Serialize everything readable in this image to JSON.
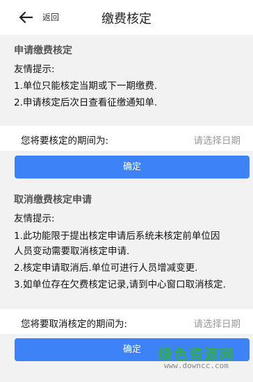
{
  "header": {
    "back_label": "返回",
    "title": "缴费核定"
  },
  "apply_section": {
    "title": "申请缴费核定",
    "tips": [
      "友情提示:",
      "1.单位只能核定当期或下一期缴费.",
      "2.申请核定后次日查看征缴通知单."
    ],
    "period_label": "您将要核定的期间为:",
    "period_placeholder": "请选择日期",
    "confirm_label": "确定"
  },
  "cancel_section": {
    "title": "取消缴费核定申请",
    "tips": [
      "友情提示:",
      "1.此功能限于提出核定申请后系统未核定前单位因",
      "人员变动需要取消核定申请.",
      "2.核定申请取消后.单位可进行人员增减变更.",
      "3.如单位存在欠费核定记录,请到中心窗口取消核定."
    ],
    "period_label": "您将要取消核定的期间为:",
    "period_placeholder": "请选择日期",
    "confirm_label": "确定"
  },
  "watermark": {
    "logo": "绿色资源网",
    "url": "www.downcc.com"
  },
  "colors": {
    "accent": "#3e82f7",
    "background": "#f2f2f2",
    "placeholder": "#999999"
  }
}
